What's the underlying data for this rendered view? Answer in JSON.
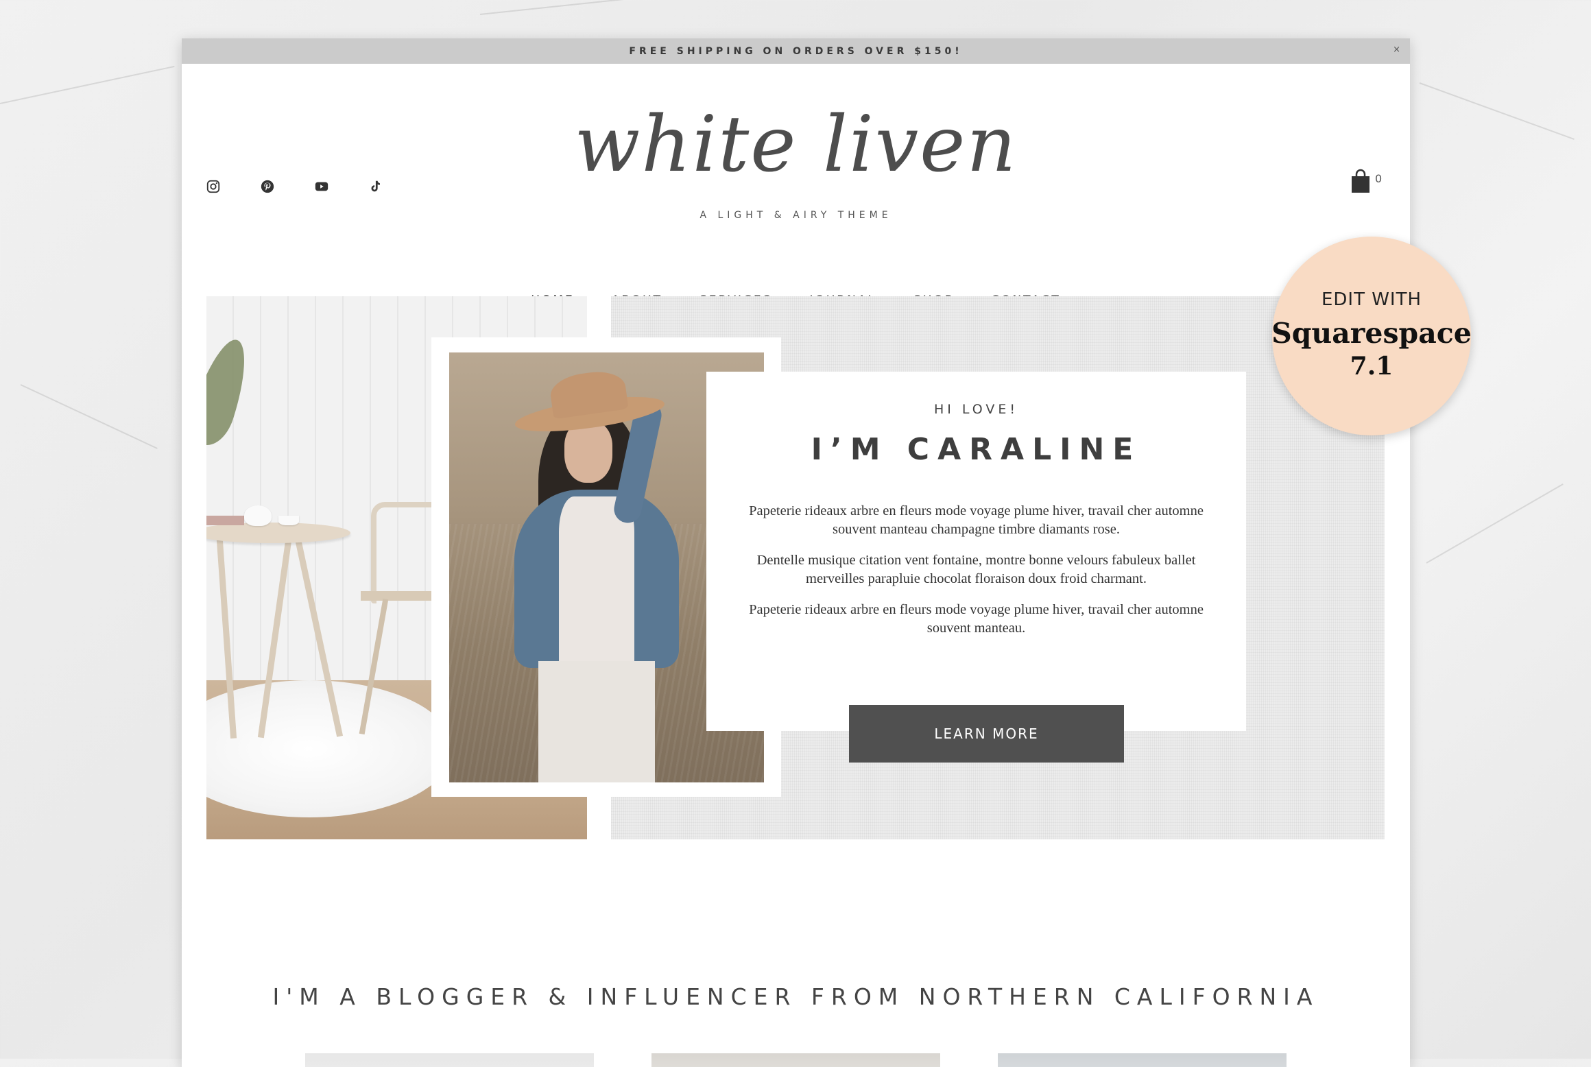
{
  "announcement": {
    "text": "FREE SHIPPING ON ORDERS OVER $150!",
    "close": "×"
  },
  "header": {
    "logo": "white liven",
    "tagline": "A LIGHT & AIRY THEME",
    "social_icons": [
      "instagram-icon",
      "pinterest-icon",
      "youtube-icon",
      "tiktok-icon"
    ],
    "cart_count": "0"
  },
  "nav": {
    "items": [
      {
        "label": "HOME",
        "active": true
      },
      {
        "label": "ABOUT"
      },
      {
        "label": "SERVICES"
      },
      {
        "label": "JOURNAL"
      },
      {
        "label": "SHOP"
      },
      {
        "label": "CONTACT"
      }
    ]
  },
  "hero": {
    "greeting": "HI LOVE!",
    "name": "I’M CARALINE",
    "paragraphs": [
      "Papeterie rideaux arbre en fleurs mode voyage plume hiver, travail cher automne souvent manteau champagne timbre diamants rose.",
      "Dentelle musique citation vent fontaine, montre bonne velours fabuleux ballet merveilles parapluie chocolat floraison doux froid charmant.",
      "Papeterie rideaux arbre en fleurs mode voyage plume hiver, travail cher automne souvent manteau."
    ],
    "button_label": "LEARN MORE"
  },
  "badge": {
    "line1": "EDIT WITH",
    "line2": "Squarespace",
    "line3": "7.1",
    "color": "#f9dbc4"
  },
  "section": {
    "heading": "I'M A BLOGGER & INFLUENCER FROM NORTHERN CALIFORNIA"
  },
  "colors": {
    "accent": "#505050",
    "topbar": "#cbcbcb",
    "text": "#3e3e3e"
  }
}
